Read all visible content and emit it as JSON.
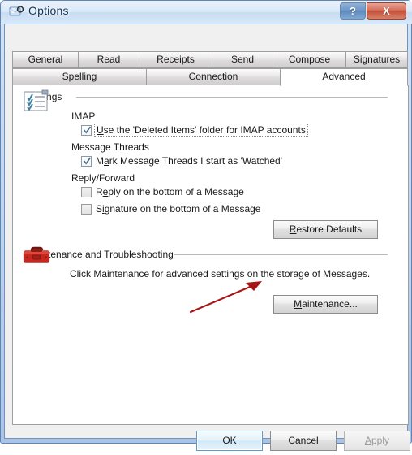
{
  "window": {
    "title": "Options",
    "icon": "mail-options-icon",
    "caption_buttons": [
      {
        "name": "help-button",
        "label": "?"
      },
      {
        "name": "close-button",
        "label": "X"
      }
    ]
  },
  "tabs": {
    "row1": [
      {
        "label": "General",
        "selected": false
      },
      {
        "label": "Read",
        "selected": false
      },
      {
        "label": "Receipts",
        "selected": false
      },
      {
        "label": "Send",
        "selected": false
      },
      {
        "label": "Compose",
        "selected": false
      },
      {
        "label": "Signatures",
        "selected": false
      }
    ],
    "row2": [
      {
        "label": "Spelling",
        "selected": false
      },
      {
        "label": "Connection",
        "selected": false
      },
      {
        "label": "Advanced",
        "selected": true
      }
    ]
  },
  "settings_group": {
    "label": "Settings",
    "accel": "S",
    "icon": "checklist-icon",
    "sections": [
      {
        "heading": "IMAP",
        "checkboxes": [
          {
            "label": "Use the 'Deleted Items' folder for IMAP accounts",
            "accel": "U",
            "checked": true,
            "focused": true
          }
        ]
      },
      {
        "heading": "Message Threads",
        "checkboxes": [
          {
            "label": "Mark Message Threads I start as 'Watched'",
            "accel": "a",
            "checked": true,
            "focused": false
          }
        ]
      },
      {
        "heading": "Reply/Forward",
        "checkboxes": [
          {
            "label": "Reply on the bottom of a Message",
            "accel": "e",
            "checked": false,
            "focused": false
          },
          {
            "label": "Signature on the bottom of a Message",
            "accel": "i",
            "checked": false,
            "focused": false
          }
        ]
      }
    ],
    "restore_button": {
      "label": "Restore Defaults",
      "accel": "R",
      "enabled": true
    }
  },
  "maintenance_group": {
    "label": "Maintenance and Troubleshooting",
    "icon": "toolbox-icon",
    "description": "Click Maintenance for advanced settings on the storage of Messages.",
    "maintenance_button": {
      "label": "Maintenance...",
      "accel": "M",
      "enabled": true
    }
  },
  "annotation": {
    "type": "red-arrow",
    "color": "#b11616",
    "points_to": "Maintenance..."
  },
  "footer": {
    "buttons": [
      {
        "name": "ok-button",
        "label": "OK",
        "enabled": true,
        "default": true
      },
      {
        "name": "cancel-button",
        "label": "Cancel",
        "enabled": true,
        "default": false
      },
      {
        "name": "apply-button",
        "label": "Apply",
        "accel": "A",
        "enabled": false,
        "default": false
      }
    ]
  },
  "colors": {
    "frame": "#5f85b4",
    "title_text": "#16335b",
    "close_button": "#c3503a",
    "accent_default_button": "#5d9cc4",
    "annotation_red": "#b11616",
    "toolbox_red": "#c02a22"
  }
}
